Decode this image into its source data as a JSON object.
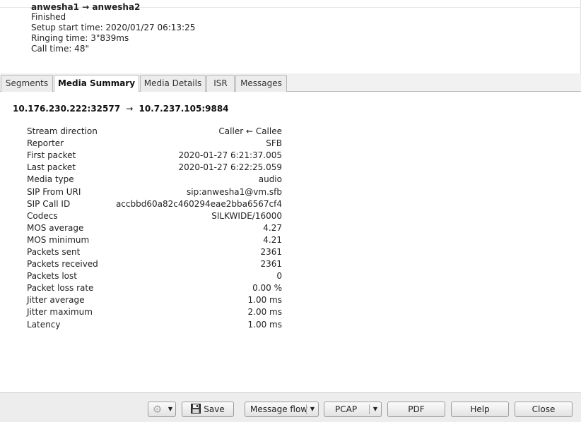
{
  "call": {
    "title": "anwesha1 → anwesha2",
    "status": "Finished",
    "setup_start": "Setup start time: 2020/01/27 06:13:25",
    "ringing": "Ringing time: 3\"839ms",
    "call_time": "Call time: 48\""
  },
  "tabs": [
    {
      "label": "Segments",
      "active": false
    },
    {
      "label": "Media Summary",
      "active": true
    },
    {
      "label": "Media Details",
      "active": false
    },
    {
      "label": "ISR",
      "active": false
    },
    {
      "label": "Messages",
      "active": false
    }
  ],
  "media": {
    "source": "10.176.230.222:32577",
    "arrow": "→",
    "destination": "10.7.237.105:9884",
    "rows": [
      {
        "label": "Stream direction",
        "value": "Caller ← Callee"
      },
      {
        "label": "Reporter",
        "value": "SFB"
      },
      {
        "label": "First packet",
        "value": "2020-01-27 6:21:37.005"
      },
      {
        "label": "Last packet",
        "value": "2020-01-27 6:22:25.059"
      },
      {
        "label": "Media type",
        "value": "audio"
      },
      {
        "label": "SIP From URI",
        "value": "sip:anwesha1@vm.sfb"
      },
      {
        "label": "SIP Call ID",
        "value": "accbbd60a82c460294eae2bba6567cf4"
      },
      {
        "label": "Codecs",
        "value": "SILKWIDE/16000"
      },
      {
        "label": "MOS average",
        "value": "4.27"
      },
      {
        "label": "MOS minimum",
        "value": "4.21"
      },
      {
        "label": "Packets sent",
        "value": "2361"
      },
      {
        "label": "Packets received",
        "value": "2361"
      },
      {
        "label": "Packets lost",
        "value": "0"
      },
      {
        "label": "Packet loss rate",
        "value": "0.00 %"
      },
      {
        "label": "Jitter average",
        "value": "1.00 ms"
      },
      {
        "label": "Jitter maximum",
        "value": "2.00 ms"
      },
      {
        "label": "Latency",
        "value": "1.00 ms"
      }
    ]
  },
  "toolbar": {
    "settings_icon": "gear-icon",
    "save_icon": "floppy-disk-icon",
    "save_label": "Save",
    "message_flow_label": "Message flow",
    "pcap_label": "PCAP",
    "pdf_label": "PDF",
    "help_label": "Help",
    "close_label": "Close",
    "dropdown_icon": "caret-down-icon"
  }
}
